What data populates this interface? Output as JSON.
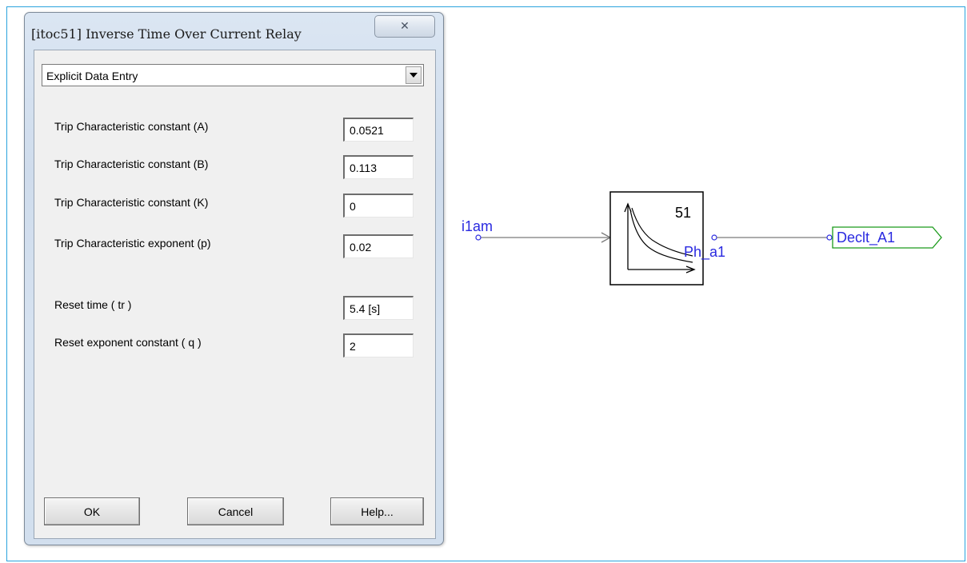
{
  "dialog": {
    "title": "[itoc51] Inverse Time Over Current Relay",
    "close_icon": "close-x-icon",
    "mode_select": {
      "value": "Explicit Data Entry"
    },
    "params": [
      {
        "label": "Trip Characteristic constant (A)",
        "value": "0.0521"
      },
      {
        "label": "Trip Characteristic constant (B)",
        "value": "0.113"
      },
      {
        "label": "Trip Characteristic constant (K)",
        "value": "0"
      },
      {
        "label": "Trip Characteristic exponent (p)",
        "value": "0.02"
      },
      {
        "label": "Reset time ( tr )",
        "value": "5.4 [s]"
      },
      {
        "label": "Reset exponent constant ( q )",
        "value": "2"
      }
    ],
    "buttons": {
      "ok": "OK",
      "cancel": "Cancel",
      "help": "Help..."
    }
  },
  "schematic": {
    "input_label": "i1am",
    "block_number": "51",
    "block_output_label": "Ph_a1",
    "block_icon": "inverse-time-curve-icon",
    "output_tag": "Declt_A1",
    "colors": {
      "wire": "#7a7a7a",
      "label": "#2a2ae0",
      "tag": "#1a9a1a",
      "frame": "#2aa3dd"
    }
  }
}
